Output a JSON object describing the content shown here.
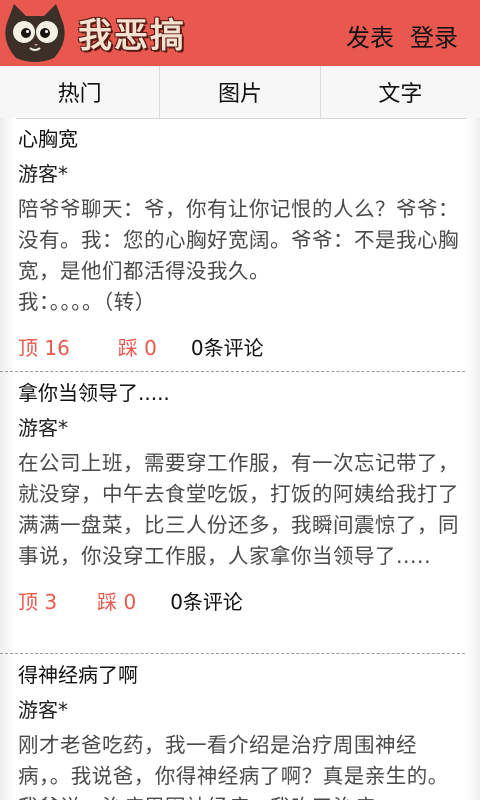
{
  "header": {
    "logo_text": "我恶搞",
    "post_label": "发表",
    "login_label": "登录",
    "bg_color": "#e8584f"
  },
  "tabs": [
    {
      "label": "热门"
    },
    {
      "label": "图片"
    },
    {
      "label": "文字"
    }
  ],
  "posts": [
    {
      "title": "心胸宽",
      "author": "游客*",
      "body": "陪爷爷聊天：爷，你有让你记恨的人么？爷爷：没有。我：您的心胸好宽阔。爷爷：不是我心胸宽，是他们都活得没我久。\n我：。。。。（转）",
      "up": "顶 16",
      "down": "踩 0",
      "comments": "0条评论"
    },
    {
      "title": "拿你当领导了.....",
      "author": "游客*",
      "body": "在公司上班，需要穿工作服，有一次忘记带了，就没穿，中午去食堂吃饭，打饭的阿姨给我打了满满一盘菜，比三人份还多，我瞬间震惊了，同事说，你没穿工作服，人家拿你当领导了.....",
      "up": "顶 3",
      "down": "踩 0",
      "comments": "0条评论"
    },
    {
      "title": "得神经病了啊",
      "author": "游客*",
      "body": "刚才老爸吃药，我一看介绍是治疗周围神经病，。我说爸，你得神经病了啊？真是亲生的。我爸说，治疗周围神经病，我吃了治疗",
      "up": "",
      "down": "",
      "comments": ""
    }
  ]
}
